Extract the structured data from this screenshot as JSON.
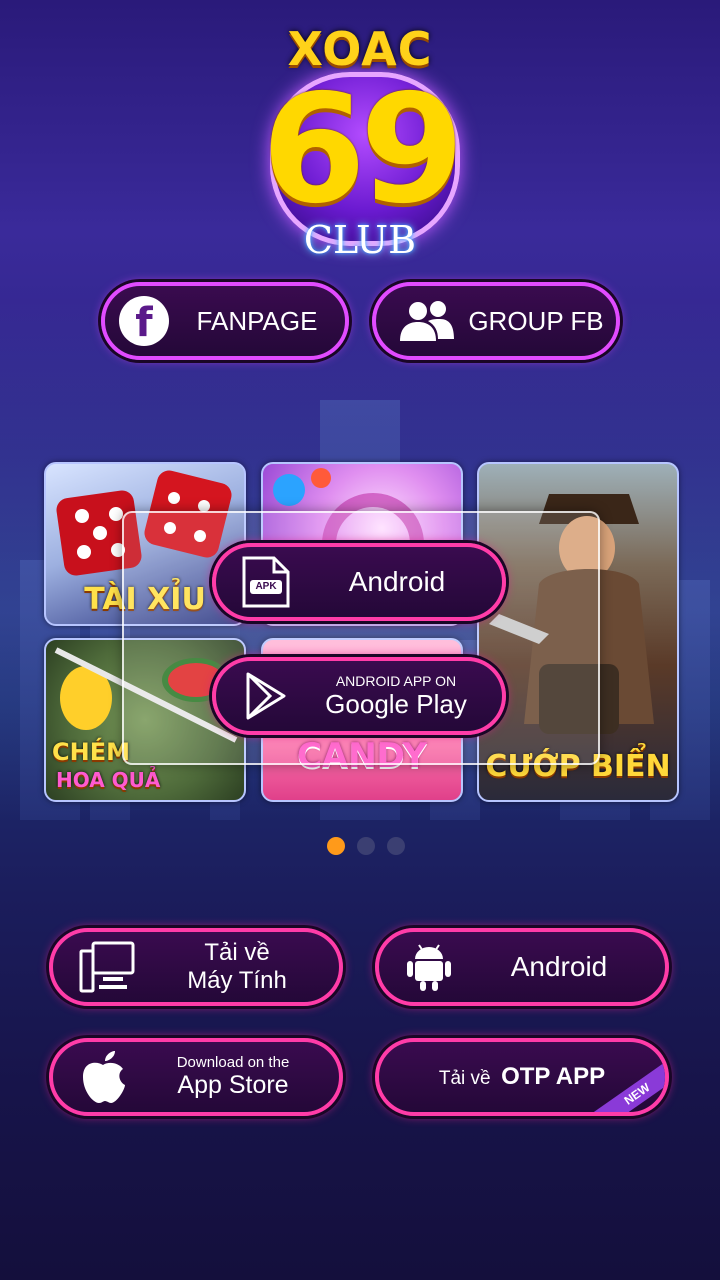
{
  "logo": {
    "top": "XOAC",
    "number": "69",
    "club": "CLUB"
  },
  "social": {
    "fanpage_label": "FANPAGE",
    "group_label": "GROUP FB"
  },
  "games": [
    {
      "label": "TÀI XỈU"
    },
    {
      "label": ""
    },
    {
      "label": "CƯỚP BIỂN"
    },
    {
      "label_line1": "CHÉM",
      "label_line2": "HOA QUẢ"
    },
    {
      "label": "CANDY"
    }
  ],
  "popup": {
    "android_label": "Android",
    "apk_badge": "APK",
    "gplay_small": "ANDROID APP ON",
    "gplay_big": "Google Play"
  },
  "pagination": {
    "count": 3,
    "active": 0
  },
  "downloads": {
    "pc_line1": "Tải về",
    "pc_line2": "Máy Tính",
    "android_label": "Android",
    "appstore_small": "Download on the",
    "appstore_big": "App Store",
    "otp_prefix": "Tải về",
    "otp_bold": "OTP APP",
    "new_badge": "NEW"
  },
  "colors": {
    "pink_border": "#ff3ca8",
    "violet_border": "#e14bff",
    "dot_active": "#ff9a1a"
  },
  "icons": [
    "facebook-icon",
    "group-users-icon",
    "apk-file-icon",
    "google-play-icon",
    "desktop-computer-icon",
    "android-robot-icon",
    "apple-icon"
  ]
}
